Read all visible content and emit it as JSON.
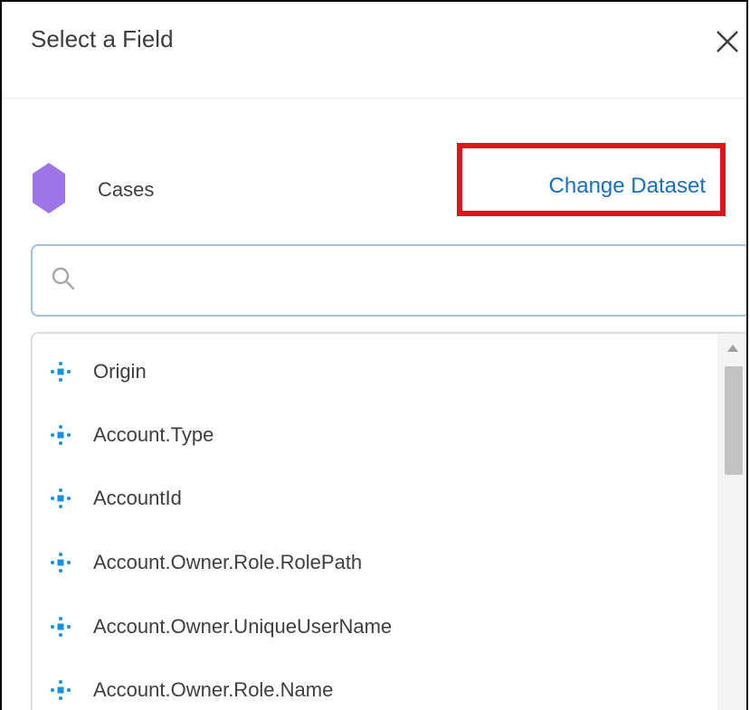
{
  "dialog": {
    "title": "Select a Field",
    "close_icon": "close-icon"
  },
  "dataset": {
    "name": "Cases",
    "icon": "dataset-hexagon-icon",
    "icon_color": "#9e75e6",
    "change_link": "Change Dataset",
    "link_color": "#1570c8",
    "highlight_color": "#e3131b"
  },
  "search": {
    "placeholder": "",
    "value": "",
    "icon": "search-icon"
  },
  "fields": [
    {
      "label": "Origin",
      "icon": "dimension-icon"
    },
    {
      "label": "Account.Type",
      "icon": "dimension-icon"
    },
    {
      "label": "AccountId",
      "icon": "dimension-icon"
    },
    {
      "label": "Account.Owner.Role.RolePath",
      "icon": "dimension-icon"
    },
    {
      "label": "Account.Owner.UniqueUserName",
      "icon": "dimension-icon"
    },
    {
      "label": "Account.Owner.Role.Name",
      "icon": "dimension-icon"
    }
  ]
}
